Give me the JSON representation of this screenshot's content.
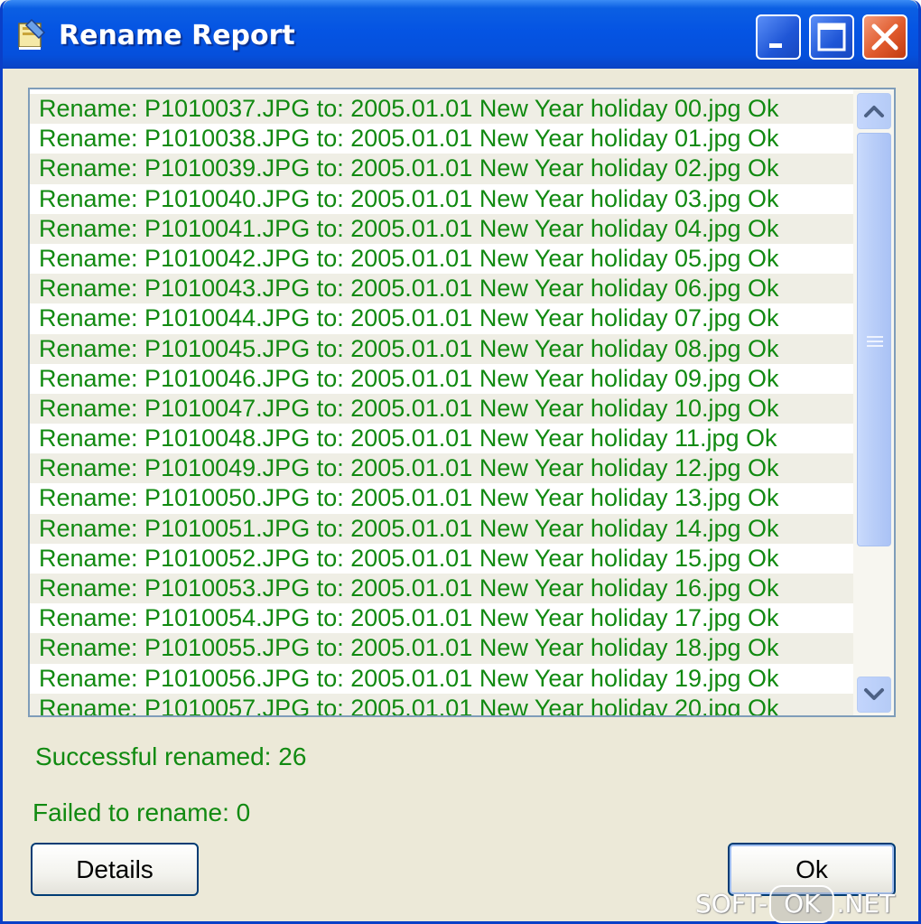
{
  "window": {
    "title": "Rename Report",
    "icon": "rename-app-icon",
    "controls": {
      "minimize_icon": "minimize-icon",
      "maximize_icon": "maximize-icon",
      "close_icon": "close-icon"
    }
  },
  "report_list": {
    "items": [
      "Rename: P1010037.JPG to: 2005.01.01 New Year holiday 00.jpg Ok",
      "Rename: P1010038.JPG to: 2005.01.01 New Year holiday 01.jpg Ok",
      "Rename: P1010039.JPG to: 2005.01.01 New Year holiday 02.jpg Ok",
      "Rename: P1010040.JPG to: 2005.01.01 New Year holiday 03.jpg Ok",
      "Rename: P1010041.JPG to: 2005.01.01 New Year holiday 04.jpg Ok",
      "Rename: P1010042.JPG to: 2005.01.01 New Year holiday 05.jpg Ok",
      "Rename: P1010043.JPG to: 2005.01.01 New Year holiday 06.jpg Ok",
      "Rename: P1010044.JPG to: 2005.01.01 New Year holiday 07.jpg Ok",
      "Rename: P1010045.JPG to: 2005.01.01 New Year holiday 08.jpg Ok",
      "Rename: P1010046.JPG to: 2005.01.01 New Year holiday 09.jpg Ok",
      "Rename: P1010047.JPG to: 2005.01.01 New Year holiday 10.jpg Ok",
      "Rename: P1010048.JPG to: 2005.01.01 New Year holiday 11.jpg Ok",
      "Rename: P1010049.JPG to: 2005.01.01 New Year holiday 12.jpg Ok",
      "Rename: P1010050.JPG to: 2005.01.01 New Year holiday 13.jpg Ok",
      "Rename: P1010051.JPG to: 2005.01.01 New Year holiday 14.jpg Ok",
      "Rename: P1010052.JPG to: 2005.01.01 New Year holiday 15.jpg Ok",
      "Rename: P1010053.JPG to: 2005.01.01 New Year holiday 16.jpg Ok",
      "Rename: P1010054.JPG to: 2005.01.01 New Year holiday 17.jpg Ok",
      "Rename: P1010055.JPG to: 2005.01.01 New Year holiday 18.jpg Ok",
      "Rename: P1010056.JPG to: 2005.01.01 New Year holiday 19.jpg Ok",
      "Rename: P1010057.JPG to: 2005.01.01 New Year holiday 20.jpg Ok"
    ],
    "scroll_up_icon": "chevron-up-icon",
    "scroll_down_icon": "chevron-down-icon"
  },
  "summary": {
    "success_text": "Successful renamed: 26",
    "failed_text": "Failed to rename: 0"
  },
  "buttons": {
    "details_label": "Details",
    "ok_label": "Ok"
  },
  "watermark": {
    "left": "SOFT-",
    "middle": "OK",
    "right": ".NET"
  },
  "colors": {
    "titlebar": "#0554e3",
    "list_text": "#118a11",
    "window_bg": "#ece9d8",
    "close_button": "#e05a2c"
  }
}
